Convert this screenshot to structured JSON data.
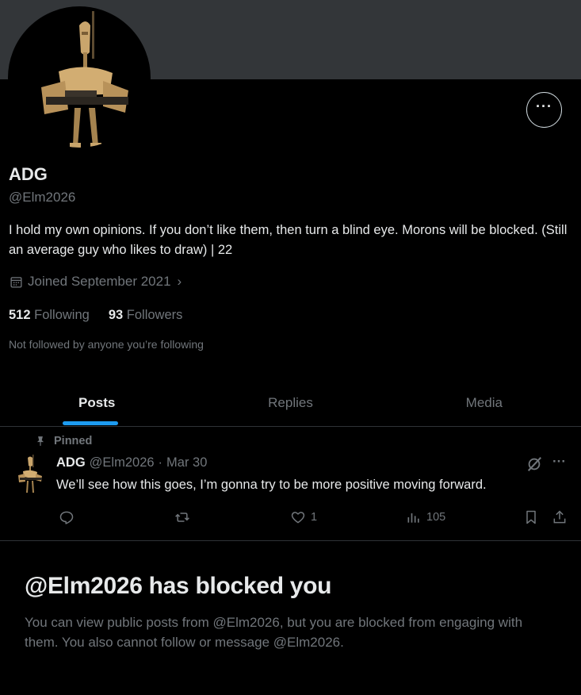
{
  "profile": {
    "name": "ADG",
    "handle": "@Elm2026",
    "bio": "I hold my own opinions. If you don’t like them, then turn a blind eye. Morons will be blocked. (Still an average guy who likes to draw) | 22",
    "joined": "Joined September 2021",
    "following_count": "512",
    "following_label": "Following",
    "followers_count": "93",
    "followers_label": "Followers",
    "not_followed": "Not followed by anyone you’re following",
    "more_icon": "more-horizontal-icon"
  },
  "tabs": [
    {
      "label": "Posts",
      "active": true
    },
    {
      "label": "Replies",
      "active": false
    },
    {
      "label": "Media",
      "active": false
    }
  ],
  "pinned_post": {
    "pinned_label": "Pinned",
    "author_name": "ADG",
    "author_handle": "@Elm2026",
    "separator": "·",
    "date": "Mar 30",
    "text": "We’ll see how this goes, I’m gonna try to be more positive moving forward.",
    "likes": "1",
    "views": "105"
  },
  "blocked": {
    "title": "@Elm2026 has blocked you",
    "description": "You can view public posts from @Elm2026, but you are blocked from engaging with them. You also cannot follow or message @Elm2026."
  },
  "colors": {
    "background": "#000000",
    "banner": "#333639",
    "accent": "#1d9bf0",
    "muted": "#71767b",
    "text": "#e7e9ea"
  }
}
